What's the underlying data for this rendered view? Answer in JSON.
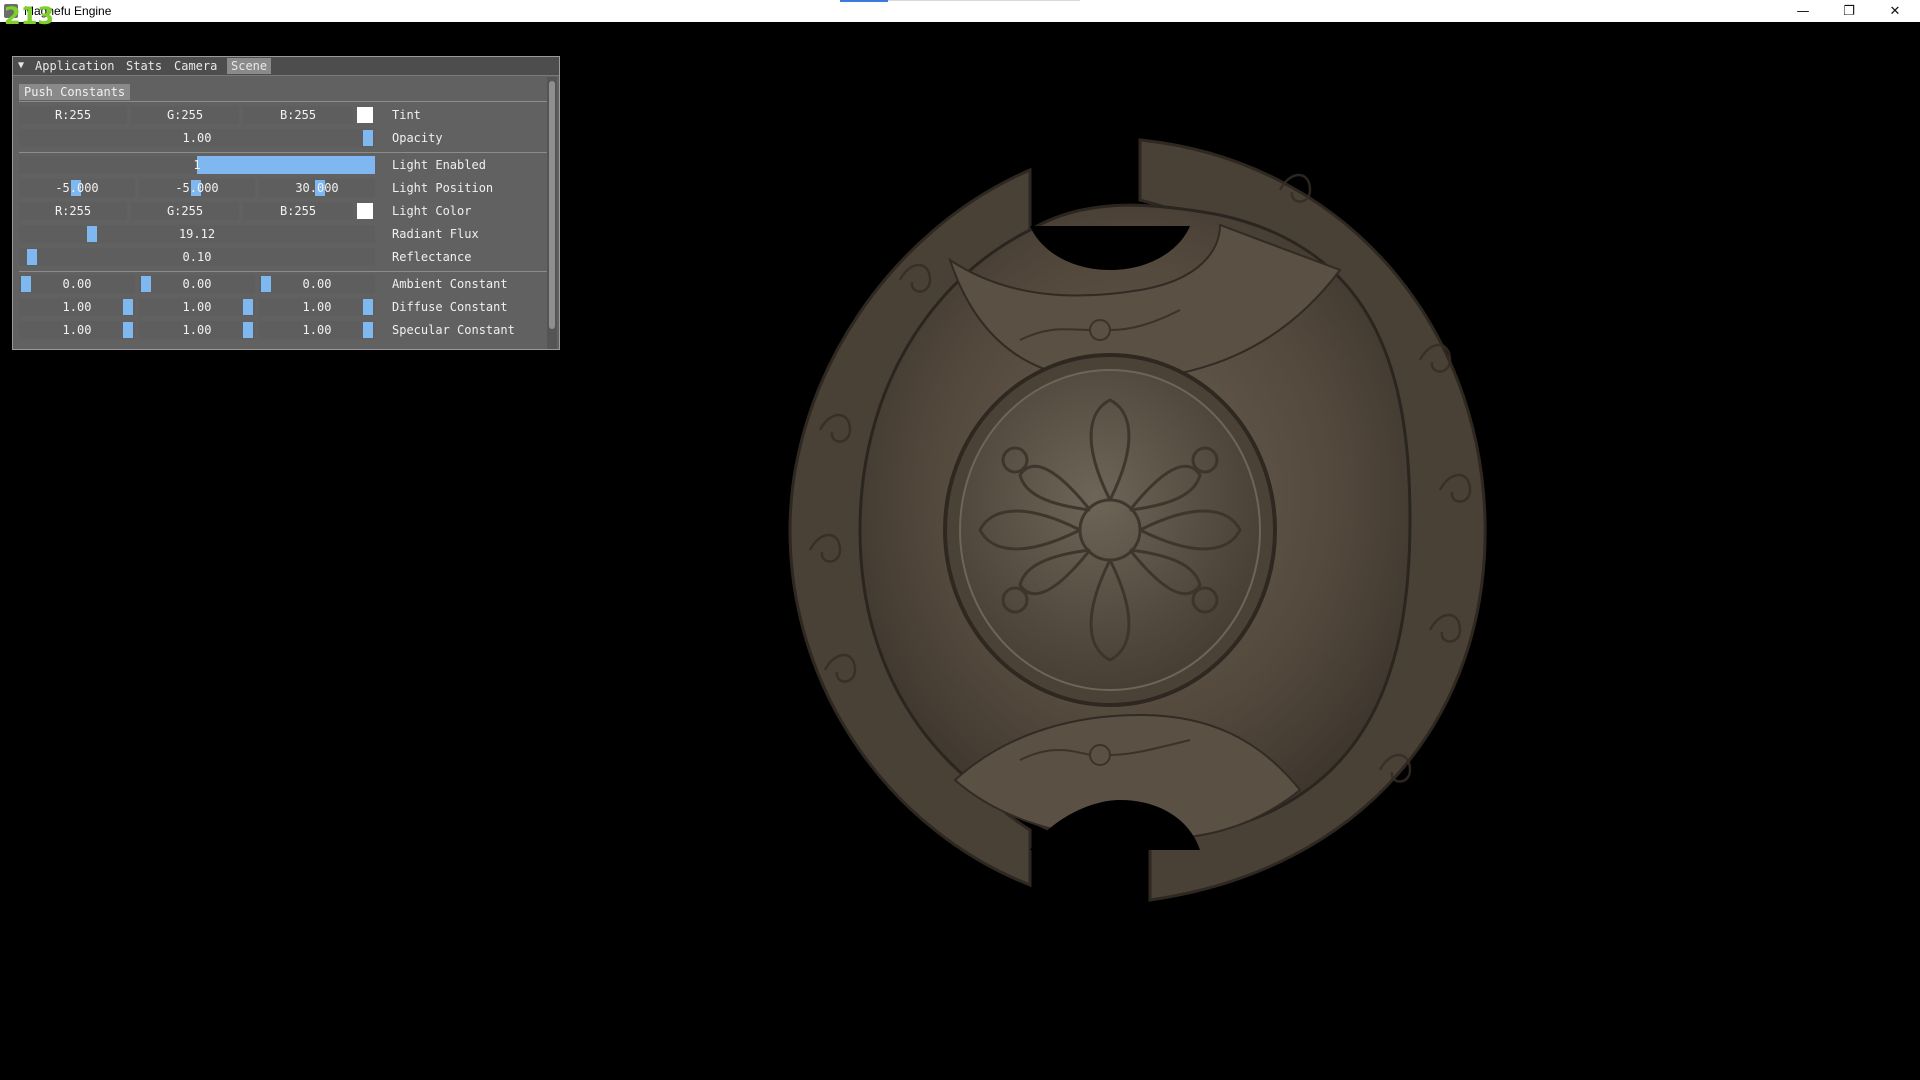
{
  "fps": "213",
  "window": {
    "title": "Magnefu Engine",
    "minimize": "—",
    "restore": "❐",
    "close": "✕"
  },
  "panel": {
    "collapse_glyph": "▼",
    "tabs": [
      "Application",
      "Stats",
      "Camera",
      "Scene"
    ],
    "active_tab": "Scene",
    "section": "Push Constants",
    "rows": {
      "tint": {
        "r": "R:255",
        "g": "G:255",
        "b": "B:255",
        "color": "#ffffff",
        "label": "Tint"
      },
      "opacity": {
        "value": "1.00",
        "fraction": 1.0,
        "label": "Opacity"
      },
      "light_enabled": {
        "value": "1",
        "fraction": 1.0,
        "label": "Light Enabled"
      },
      "light_position": {
        "x": "-5.000",
        "y": "-5.000",
        "z": "30.000",
        "label": "Light Position"
      },
      "light_color": {
        "r": "R:255",
        "g": "G:255",
        "b": "B:255",
        "color": "#ffffff",
        "label": "Light Color"
      },
      "radiant_flux": {
        "value": "19.12",
        "label": "Radiant Flux"
      },
      "reflectance": {
        "value": "0.10",
        "label": "Reflectance"
      },
      "ambient": {
        "values": [
          "0.00",
          "0.00",
          "0.00"
        ],
        "label": "Ambient Constant"
      },
      "diffuse": {
        "values": [
          "1.00",
          "1.00",
          "1.00"
        ],
        "label": "Diffuse Constant"
      },
      "specular": {
        "values": [
          "1.00",
          "1.00",
          "1.00"
        ],
        "label": "Specular Constant"
      }
    }
  },
  "colors": {
    "accent": "#7fb7f0",
    "fps": "#7dd12a",
    "shield": "#5b5144"
  }
}
